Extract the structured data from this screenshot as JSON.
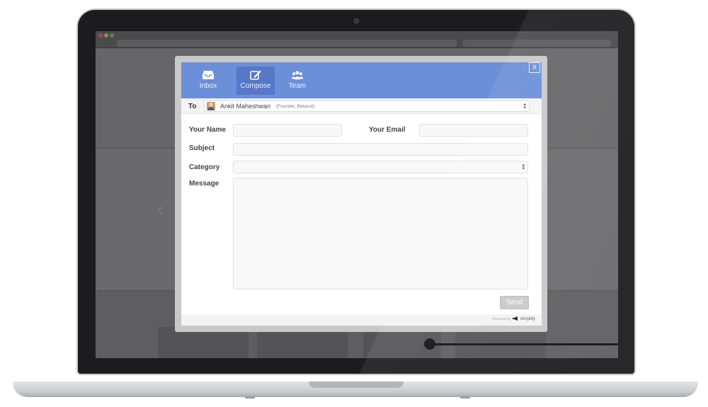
{
  "tabs": [
    {
      "label": "Inbox",
      "icon": "inbox-icon",
      "active": false
    },
    {
      "label": "Compose",
      "icon": "compose-icon",
      "active": true
    },
    {
      "label": "Team",
      "icon": "team-icon",
      "active": false
    }
  ],
  "close_label": "X",
  "to": {
    "label": "To",
    "name": "Ankit Maheshwari",
    "role": "(Founder, Betaout)"
  },
  "form": {
    "name_label": "Your Name",
    "name_value": "",
    "email_label": "Your Email",
    "email_value": "",
    "subject_label": "Subject",
    "subject_value": "",
    "category_label": "Category",
    "category_value": "",
    "message_label": "Message",
    "message_value": ""
  },
  "send_label": "Send",
  "footer": {
    "powered_prefix": "Powered by",
    "brand": "Amplify"
  },
  "colors": {
    "header": "#6b8fd8",
    "active_tab": "#5578c7",
    "send_button": "#c9c9c9"
  }
}
